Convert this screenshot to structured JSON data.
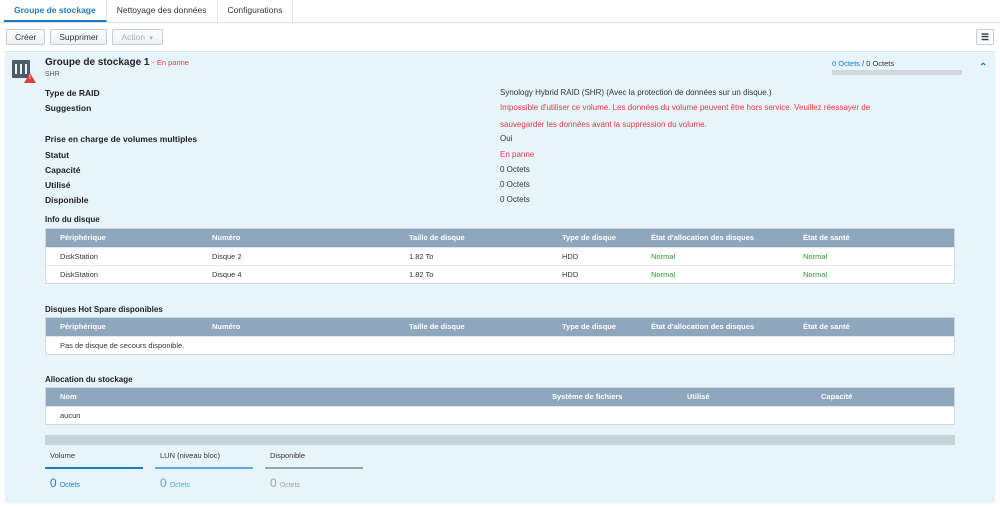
{
  "tabs": [
    "Groupe de stockage",
    "Nettoyage des données",
    "Configurations"
  ],
  "toolbar": {
    "create": "Créer",
    "delete": "Supprimer",
    "action": "Action"
  },
  "pool": {
    "title": "Groupe de stockage 1",
    "status": "- En panne",
    "subtitle": "SHR",
    "usage_used": "0 Octets",
    "usage_total": "/ 0 Octets",
    "usage_fraction": 0
  },
  "properties": [
    {
      "label": "Type de RAID",
      "value": "Synology Hybrid RAID (SHR) (Avec la protection de données sur un disque.)",
      "red": false
    },
    {
      "label": "Suggestion",
      "value": "Impossible d'utiliser ce volume. Les données du volume peuvent être hors service. Veuillez réessayer de",
      "value2": "sauvegarder les données avant la suppression du volume.",
      "red": true
    },
    {
      "label": "Prise en charge de volumes multiples",
      "value": "Oui",
      "red": false
    },
    {
      "label": "Statut",
      "value": "En panne",
      "red": true
    },
    {
      "label": "Capacité",
      "value": "0 Octets",
      "red": false
    },
    {
      "label": "Utilisé",
      "value": "0 Octets",
      "red": false
    },
    {
      "label": "Disponible",
      "value": "0 Octets",
      "red": false
    }
  ],
  "disk_info": {
    "title": "Info du disque",
    "headers": [
      "Périphérique",
      "Numéro",
      "Taille de disque",
      "Type de disque",
      "État d'allocation des disques",
      "État de santé"
    ],
    "rows": [
      [
        "DiskStation",
        "Disque 2",
        "1.82 To",
        "HDD",
        "Normal",
        "Normal"
      ],
      [
        "DiskStation",
        "Disque 4",
        "1.82 To",
        "HDD",
        "Normal",
        "Normal"
      ]
    ]
  },
  "hot_spare": {
    "title": "Disques Hot Spare disponibles",
    "headers": [
      "Périphérique",
      "Numéro",
      "Taille de disque",
      "Type de disque",
      "État d'allocation des disques",
      "État de santé"
    ],
    "empty": "Pas de disque de secours disponible."
  },
  "allocation": {
    "title": "Allocation du stockage",
    "headers": [
      "Nom",
      "Système de fichiers",
      "Utilisé",
      "Capacité"
    ],
    "row": "aucun",
    "legend": [
      {
        "label": "Volume",
        "value": "0",
        "unit": "Octets",
        "color": "#1b7bc7"
      },
      {
        "label": "LUN (niveau bloc)",
        "value": "0",
        "unit": "Octets",
        "color": "#5aa9e6"
      },
      {
        "label": "Disponible",
        "value": "0",
        "unit": "Octets",
        "color": "#9aa4ad"
      }
    ]
  }
}
